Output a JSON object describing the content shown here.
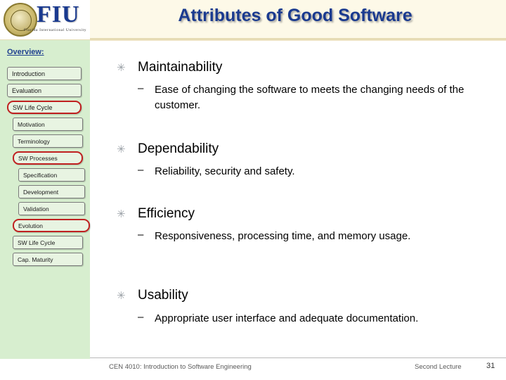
{
  "header": {
    "title": "Attributes of Good Software",
    "logo": {
      "letters": "FIU",
      "subtitle": "Florida International University",
      "seal_name": "fiu-seal"
    }
  },
  "sidebar": {
    "overview_label": "Overview:",
    "items": [
      {
        "label": "Introduction",
        "highlighted": false,
        "indent": false
      },
      {
        "label": "Evaluation",
        "highlighted": false,
        "indent": false
      },
      {
        "label": "SW Life Cycle",
        "highlighted": true,
        "indent": false
      },
      {
        "label": "Motivation",
        "highlighted": false,
        "indent": true
      },
      {
        "label": "Terminology",
        "highlighted": false,
        "indent": true
      },
      {
        "label": "SW Processes",
        "highlighted": true,
        "indent": true
      },
      {
        "label": "Specification",
        "highlighted": false,
        "indent": true
      },
      {
        "label": "Development",
        "highlighted": false,
        "indent": true
      },
      {
        "label": "Validation",
        "highlighted": false,
        "indent": true
      },
      {
        "label": "Evolution",
        "highlighted": true,
        "indent": true
      },
      {
        "label": "SW Life Cycle",
        "highlighted": false,
        "indent": false
      },
      {
        "label": "Cap. Maturity",
        "highlighted": false,
        "indent": false
      }
    ]
  },
  "main": {
    "bullet_glyph": "✳",
    "dash_glyph": "–",
    "bullets": [
      {
        "title": "Maintainability",
        "sub": "Ease of changing the software to meets the changing needs of the customer."
      },
      {
        "title": "Dependability",
        "sub": "Reliability, security and safety."
      },
      {
        "title": "Efficiency",
        "sub": "Responsiveness, processing time, and memory usage."
      },
      {
        "title": "Usability",
        "sub": "Appropriate user interface and adequate documentation."
      }
    ]
  },
  "footer": {
    "left": "CEN 4010: Introduction to Software Engineering",
    "right": "Second Lecture",
    "page": "31"
  }
}
